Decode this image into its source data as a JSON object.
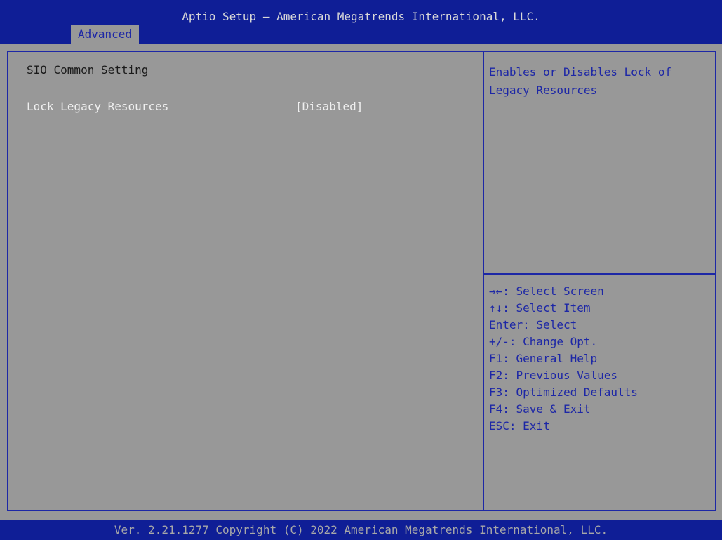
{
  "window": {
    "title": "Aptio Setup – American Megatrends International, LLC."
  },
  "tabs": [
    {
      "label": "Advanced",
      "selected": true
    }
  ],
  "main": {
    "section_heading": "SIO Common Setting",
    "settings": [
      {
        "label": "Lock Legacy Resources",
        "value": "[Disabled]"
      }
    ]
  },
  "help": {
    "text": "Enables or Disables Lock of Legacy Resources"
  },
  "keys": [
    "→←: Select Screen",
    "↑↓: Select Item",
    "Enter: Select",
    "+/-: Change Opt.",
    "F1: General Help",
    "F2: Previous Values",
    "F3: Optimized Defaults",
    "F4: Save & Exit",
    "ESC: Exit"
  ],
  "footer": {
    "text": "Ver. 2.21.1277 Copyright (C) 2022 American Megatrends International, LLC."
  },
  "colors": {
    "header_bg": "#0f1e96",
    "body_bg": "#989898",
    "accent": "#1d27a6",
    "setting_text": "#f0f0f0"
  }
}
